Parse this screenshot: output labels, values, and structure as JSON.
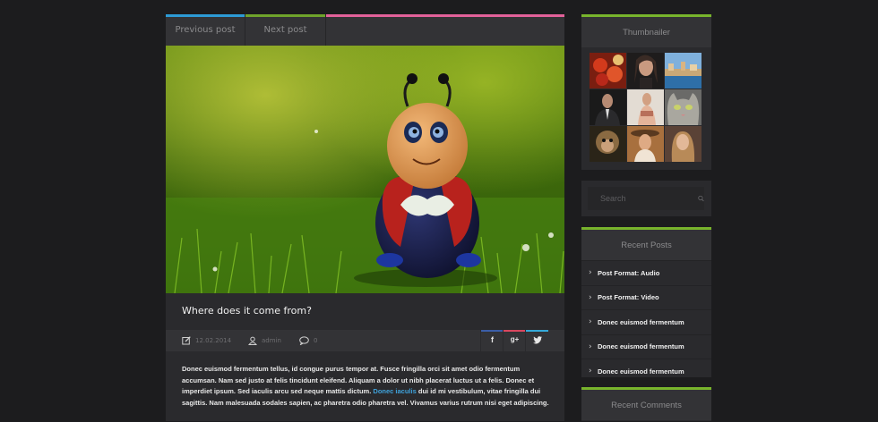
{
  "post_nav": {
    "previous_label": "Previous post",
    "next_label": "Next post",
    "colors": {
      "previous": "#2d9bd6",
      "next": "#6fa32b",
      "rest": "#e2619a"
    }
  },
  "post": {
    "title": "Where does it come from?",
    "date": "12.02.2014",
    "author": "admin",
    "comments_count": "0",
    "share": [
      {
        "name": "facebook",
        "glyph": "f",
        "color": "#3b5ea8"
      },
      {
        "name": "google-plus",
        "glyph": "g+",
        "color": "#d9475f"
      },
      {
        "name": "twitter",
        "glyph": "t",
        "color": "#34a8d8"
      }
    ],
    "body_before_link": "Donec euismod fermentum tellus, id congue purus tempor at. Fusce fringilla orci sit amet odio fermentum accumsan. Nam sed justo at felis tincidunt eleifend. Aliquam a dolor ut nibh placerat luctus ut a felis. Donec et imperdiet ipsum. Sed iaculis arcu sed neque mattis dictum.",
    "body_link": "Donec iaculis",
    "body_after_link": "dui id mi vestibulum, vitae fringilla dui sagittis. Nam malesuada sodales sapien, ac pharetra odio pharetra vel. Vivamus varius rutrum nisi eget adipiscing."
  },
  "sidebar": {
    "thumbnailer": {
      "title": "Thumbnailer",
      "accent": "#78b42c",
      "images": [
        "strawberries",
        "woman-portrait",
        "harbor-town",
        "man-in-suit",
        "woman-fashion",
        "cat-face",
        "monkey",
        "woman-hat",
        "woman-blonde"
      ]
    },
    "search": {
      "placeholder": "Search"
    },
    "recent_posts": {
      "title": "Recent Posts",
      "items": [
        {
          "label": "Post Format: Audio"
        },
        {
          "label": "Post Format: Video"
        },
        {
          "label": "Donec euismod fermentum"
        },
        {
          "label": "Donec euismod fermentum"
        },
        {
          "label": "Donec euismod fermentum"
        }
      ]
    },
    "recent_comments": {
      "title": "Recent Comments"
    }
  }
}
